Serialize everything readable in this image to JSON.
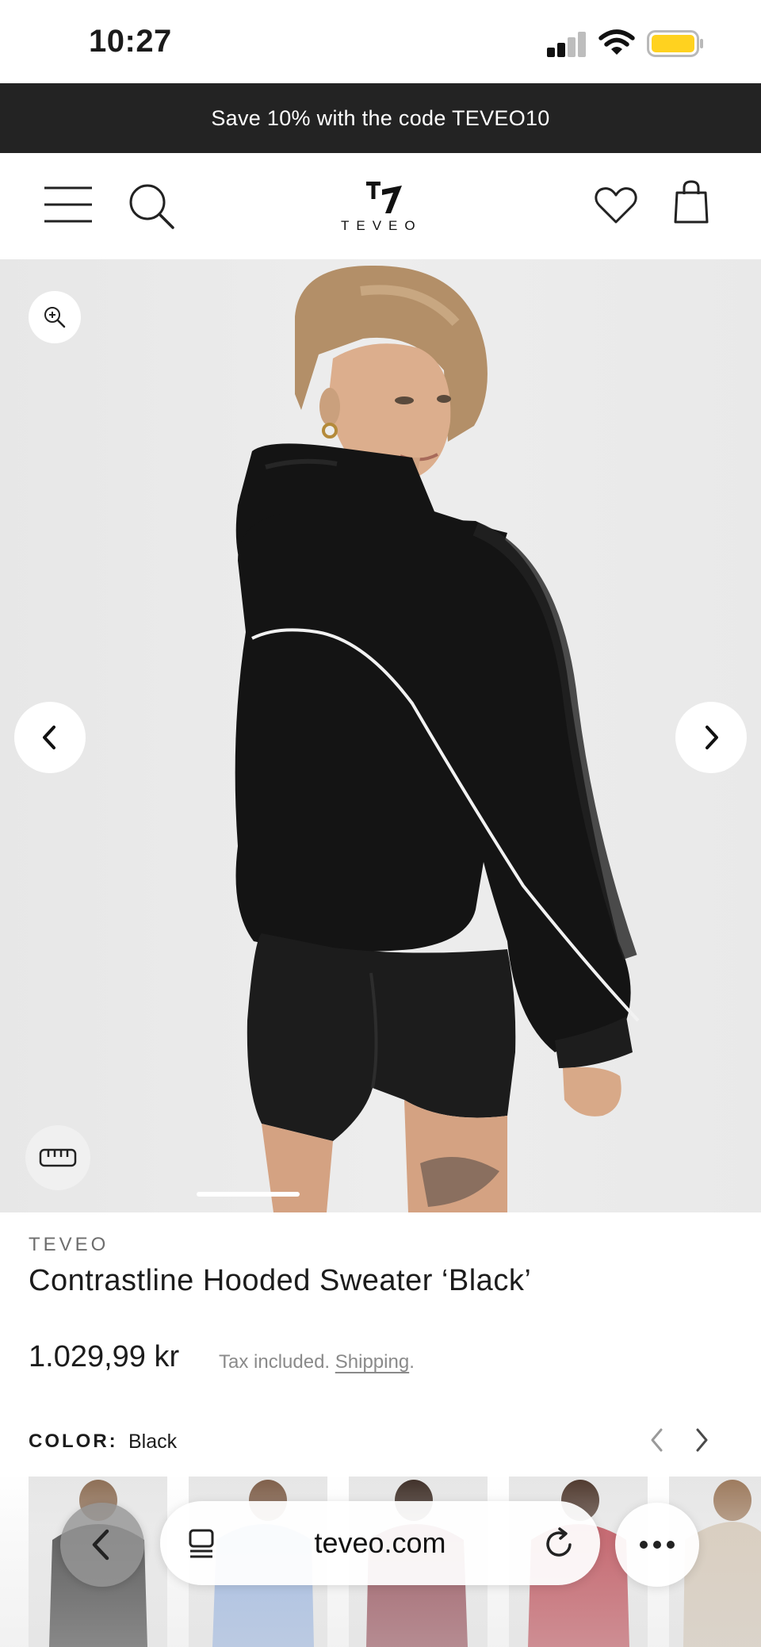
{
  "status_bar": {
    "time": "10:27"
  },
  "promo": {
    "text": "Save 10% with the code TEVEO10"
  },
  "header": {
    "logo_text": "TEVEO"
  },
  "product": {
    "brand": "TEVEO",
    "title": "Contrastline Hooded Sweater ‘Black’",
    "price": "1.029,99 kr",
    "tax_note": "Tax included.",
    "shipping_link": "Shipping",
    "tax_note_end": ".",
    "color_label": "COLOR:",
    "color_value": "Black",
    "color_swatches": [
      "Black",
      "Light Blue",
      "Burgundy",
      "Red",
      "Beige"
    ],
    "gallery_position": 1
  },
  "browser": {
    "url": "teveo.com"
  },
  "colors": {
    "promo_bg": "#232323",
    "battery": "#ffd21f",
    "hoodie": "#141414"
  },
  "icons": [
    "menu-icon",
    "search-icon",
    "heart-icon",
    "bag-icon",
    "zoom-icon",
    "chevron-left-icon",
    "chevron-right-icon",
    "ruler-icon",
    "reader-icon",
    "reload-icon",
    "more-icon"
  ]
}
